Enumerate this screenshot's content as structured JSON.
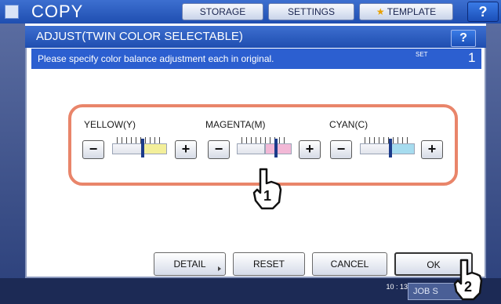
{
  "topbar": {
    "title": "COPY",
    "buttons": [
      {
        "label": "STORAGE"
      },
      {
        "label": "SETTINGS"
      },
      {
        "label": "TEMPLATE"
      }
    ],
    "help_label": "?"
  },
  "dialog": {
    "title": "ADJUST(TWIN COLOR SELECTABLE)",
    "help_label": "?",
    "message": "Please specify color balance adjustment each in original.",
    "set_label": "SET",
    "set_value": "1"
  },
  "sliders": [
    {
      "label": "YELLOW(Y)",
      "minus": "−",
      "plus": "+",
      "color": "#f3ef9a",
      "level": 0.55
    },
    {
      "label": "MAGENTA(M)",
      "minus": "−",
      "plus": "+",
      "color": "#f2b8d6",
      "level": 0.72
    },
    {
      "label": "CYAN(C)",
      "minus": "−",
      "plus": "+",
      "color": "#a6dcef",
      "level": 0.55
    }
  ],
  "buttons": {
    "detail": "DETAIL",
    "reset": "RESET",
    "cancel": "CANCEL",
    "ok": "OK"
  },
  "footer": {
    "time": "10 : 13",
    "job_status": "JOB S"
  },
  "callouts": {
    "step1": "1",
    "step2": "2"
  },
  "colors": {
    "titlebar": "#1f4eb0",
    "highlight": "#e9856a"
  }
}
